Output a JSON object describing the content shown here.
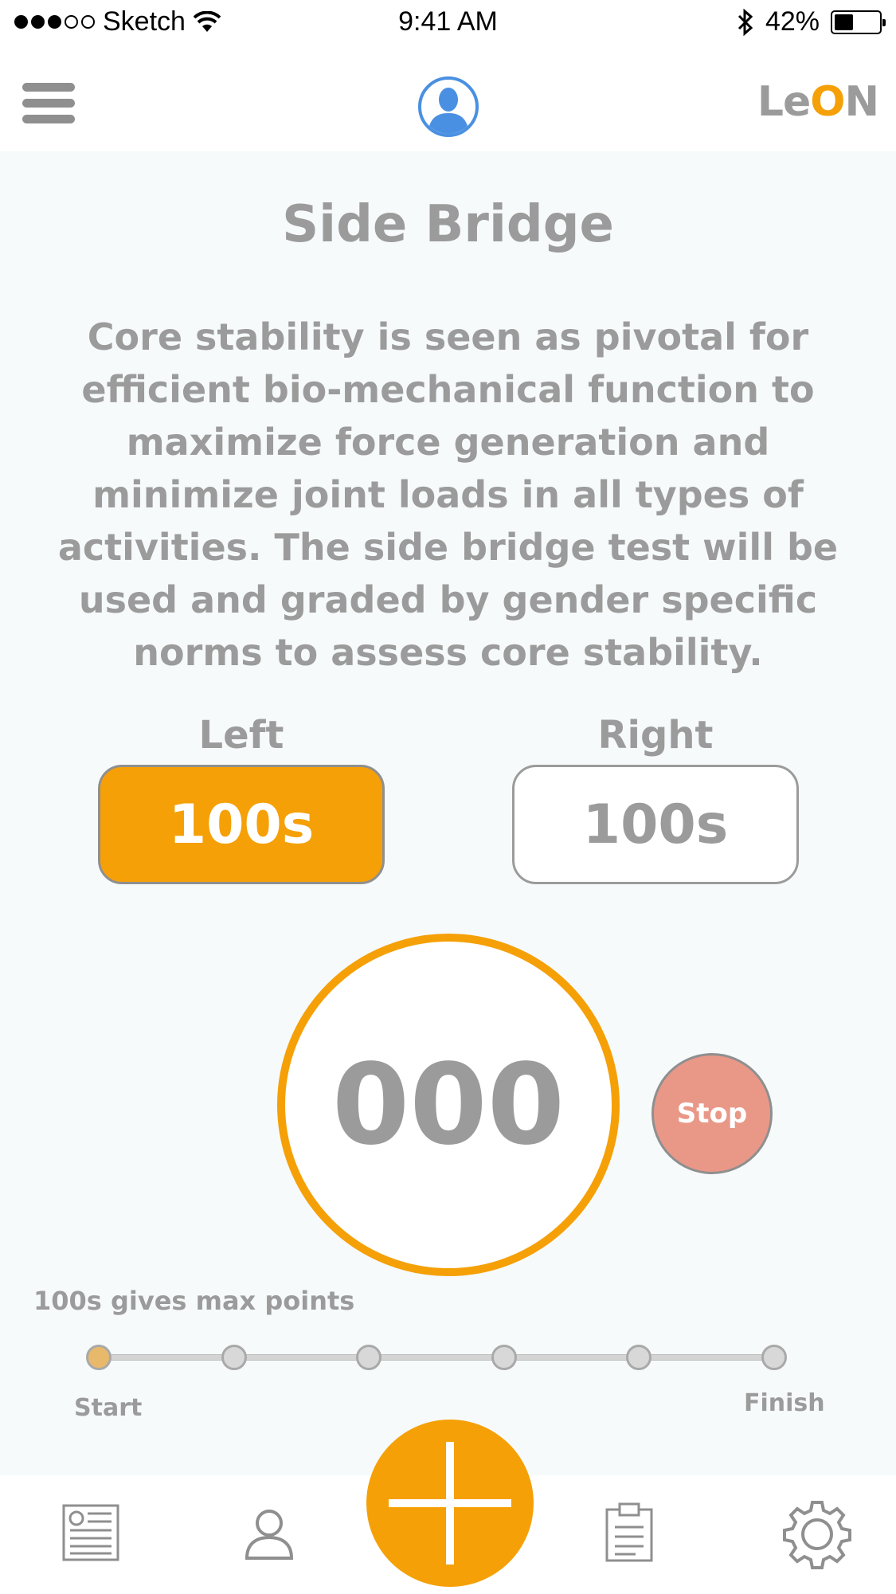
{
  "status_bar": {
    "carrier": "Sketch",
    "time": "9:41 AM",
    "battery_percent": "42%",
    "battery_level": 0.42,
    "signal_bars": 3,
    "signal_total": 5
  },
  "header": {
    "brand_prefix": "Le",
    "brand_o": "O",
    "brand_suffix": "N",
    "accent_color": "#f5a007",
    "avatar_color": "#4a90e2"
  },
  "exercise": {
    "title": "Side Bridge",
    "description": "Core stability is seen as pivotal for efficient bio-mechanical function to maximize force generation and minimize joint loads in all types of activities. The side bridge test will be used and graded by gender specific norms to assess core stability."
  },
  "sides": {
    "left_label": "Left",
    "left_value": "100s",
    "right_label": "Right",
    "right_value": "100s"
  },
  "timer": {
    "value": "000",
    "stop_label": "Stop",
    "stop_color": "#e99888"
  },
  "progress": {
    "hint": "100s gives max points",
    "start_label": "Start",
    "finish_label": "Finish",
    "steps": 6,
    "current_step": 1
  },
  "tabbar": {
    "items": [
      "news-icon",
      "profile-icon",
      "add-icon",
      "clipboard-icon",
      "settings-icon"
    ]
  }
}
